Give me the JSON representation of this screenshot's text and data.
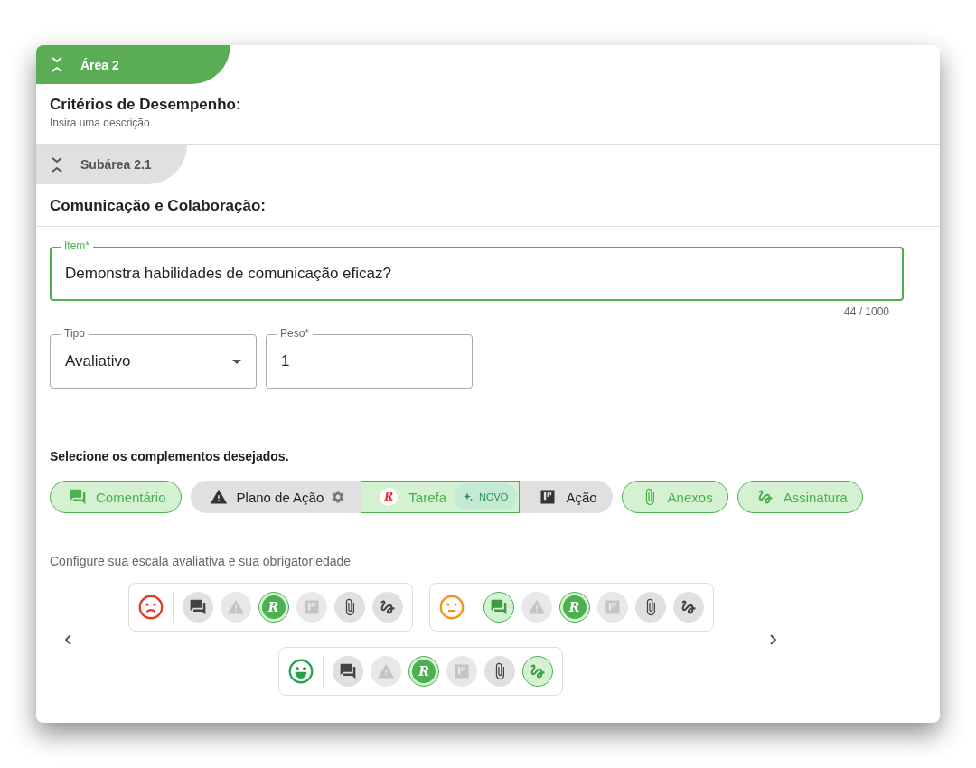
{
  "area": {
    "title": "Área 2",
    "heading": "Critérios de Desempenho:",
    "description": "Insira uma descrição"
  },
  "subarea": {
    "title": "Subárea 2.1",
    "heading": "Comunicação e Colaboração:"
  },
  "item_field": {
    "label": "Item*",
    "value": "Demonstra habilidades de comunicação eficaz?",
    "counter": "44 / 1000"
  },
  "type_field": {
    "label": "Tipo",
    "value": "Avaliativo"
  },
  "weight_field": {
    "label": "Peso*",
    "value": "1"
  },
  "complements": {
    "title": "Selecione os complementos desejados.",
    "items": [
      {
        "kind": "comment",
        "label": "Comentário",
        "selected": true
      },
      {
        "kind": "group",
        "items": [
          {
            "kind": "warning",
            "label": "Plano de Ação",
            "selected": false,
            "settings": true
          },
          {
            "kind": "logo",
            "letter": "R",
            "label": "Tarefa",
            "selected": true,
            "badge": "NOVO"
          },
          {
            "kind": "board",
            "label": "Ação",
            "selected": false
          }
        ]
      },
      {
        "kind": "attach",
        "label": "Anexos",
        "selected": true
      },
      {
        "kind": "signature",
        "label": "Assinatura",
        "selected": true
      }
    ]
  },
  "scale": {
    "title": "Configure sua escala avaliativa e sua obrigatoriedade",
    "rows": [
      {
        "kind": "sad",
        "color": "#e53a1e",
        "options": [
          {
            "kind": "comment",
            "selected": false,
            "disabled": false
          },
          {
            "kind": "warning",
            "selected": false,
            "disabled": true
          },
          {
            "kind": "logo",
            "letter": "R",
            "selected": true,
            "disabled": false
          },
          {
            "kind": "board",
            "selected": false,
            "disabled": true
          },
          {
            "kind": "attach",
            "selected": false,
            "disabled": false
          },
          {
            "kind": "signature",
            "selected": false,
            "disabled": false
          }
        ]
      },
      {
        "kind": "neutral",
        "color": "#f5921e",
        "options": [
          {
            "kind": "comment",
            "selected": true,
            "disabled": false
          },
          {
            "kind": "warning",
            "selected": false,
            "disabled": true
          },
          {
            "kind": "logo",
            "letter": "R",
            "selected": true,
            "disabled": false
          },
          {
            "kind": "board",
            "selected": false,
            "disabled": true
          },
          {
            "kind": "attach",
            "selected": false,
            "disabled": false
          },
          {
            "kind": "signature",
            "selected": false,
            "disabled": false
          }
        ]
      },
      {
        "kind": "happy",
        "color": "#27a350",
        "options": [
          {
            "kind": "comment",
            "selected": false,
            "disabled": false
          },
          {
            "kind": "warning",
            "selected": false,
            "disabled": true
          },
          {
            "kind": "logo",
            "letter": "R",
            "selected": true,
            "disabled": false
          },
          {
            "kind": "board",
            "selected": false,
            "disabled": true
          },
          {
            "kind": "attach",
            "selected": false,
            "disabled": false
          },
          {
            "kind": "signature",
            "selected": true,
            "disabled": false
          }
        ]
      }
    ]
  }
}
